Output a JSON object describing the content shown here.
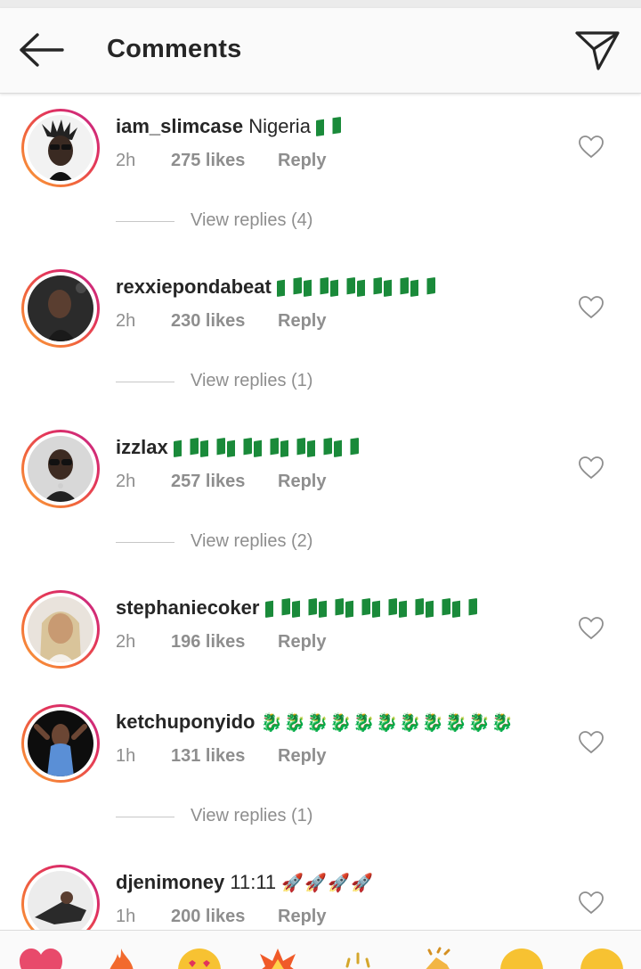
{
  "header": {
    "title": "Comments",
    "back_icon": "arrow-left-icon",
    "send_icon": "paper-plane-icon"
  },
  "comments": [
    {
      "username": "iam_slimcase",
      "text": "Nigeria",
      "emoji": "🇳🇬",
      "time": "2h",
      "likes": "275 likes",
      "reply": "Reply",
      "view_replies": "View replies (4)"
    },
    {
      "username": "rexxiepondabeat",
      "text": "",
      "emoji": "🇳🇬🇳🇬🇳🇬🇳🇬🇳🇬🇳🇬",
      "time": "2h",
      "likes": "230 likes",
      "reply": "Reply",
      "view_replies": "View replies (1)"
    },
    {
      "username": "izzlax",
      "text": "",
      "emoji": "🇳🇬🇳🇬🇳🇬🇳🇬🇳🇬🇳🇬🇳🇬",
      "time": "2h",
      "likes": "257 likes",
      "reply": "Reply",
      "view_replies": "View replies (2)"
    },
    {
      "username": "stephaniecoker",
      "text": "",
      "emoji": "🇳🇬🇳🇬🇳🇬🇳🇬🇳🇬🇳🇬🇳🇬🇳🇬",
      "time": "2h",
      "likes": "196 likes",
      "reply": "Reply",
      "view_replies": ""
    },
    {
      "username": "ketchuponyido",
      "text": "",
      "emoji": "🐉🐉🐉🐉🐉🐉🐉🐉🐉🐉🐉",
      "time": "1h",
      "likes": "131 likes",
      "reply": "Reply",
      "view_replies": "View replies (1)"
    },
    {
      "username": "djenimoney",
      "text": "11:11",
      "emoji": "🚀🚀🚀🚀",
      "time": "1h",
      "likes": "200 likes",
      "reply": "Reply",
      "view_replies": ""
    }
  ],
  "emoji_bar": {
    "items": [
      "❤️",
      "🔥",
      "😍",
      "💥",
      "🎉",
      "👏",
      "😊",
      "😊"
    ]
  },
  "colors": {
    "ring_gradient_start": "#f9a13a",
    "ring_gradient_end": "#c2258e",
    "secondary_text": "#8e8e8e",
    "flag_green": "#1a8a3a"
  }
}
